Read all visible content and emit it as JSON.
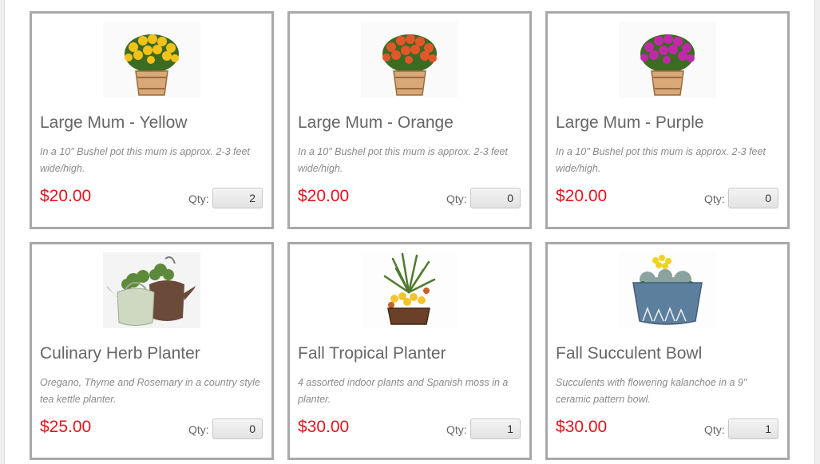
{
  "products": [
    {
      "name": "Large Mum - Yellow",
      "description": "In a 10\" Bushel pot this mum is approx. 2-3 feet wide/high.",
      "price": "$20.00",
      "qty_label": "Qty:",
      "qty_value": "2",
      "image_icon": "yellow-mum-basket-image",
      "flower_color": "#f2c21b"
    },
    {
      "name": "Large Mum - Orange",
      "description": "In a 10\" Bushel pot this mum is approx. 2-3 feet wide/high.",
      "price": "$20.00",
      "qty_label": "Qty:",
      "qty_value": "0",
      "image_icon": "orange-mum-basket-image",
      "flower_color": "#e2562b"
    },
    {
      "name": "Large Mum - Purple",
      "description": "In a 10\" Bushel pot this mum is approx. 2-3 feet wide/high.",
      "price": "$20.00",
      "qty_label": "Qty:",
      "qty_value": "0",
      "image_icon": "purple-mum-basket-image",
      "flower_color": "#c02aa8"
    },
    {
      "name": "Culinary Herb Planter",
      "description": "Oregano, Thyme and Rosemary in a country style tea kettle planter.",
      "price": "$25.00",
      "qty_label": "Qty:",
      "qty_value": "0",
      "image_icon": "herb-kettle-planter-image"
    },
    {
      "name": "Fall Tropical Planter",
      "description": "4 assorted indoor plants and Spanish moss in a planter.",
      "price": "$30.00",
      "qty_label": "Qty:",
      "qty_value": "1",
      "image_icon": "tropical-planter-image"
    },
    {
      "name": "Fall Succulent Bowl",
      "description": "Succulents with flowering kalanchoe in a 9\" ceramic pattern bowl.",
      "price": "$30.00",
      "qty_label": "Qty:",
      "qty_value": "1",
      "image_icon": "succulent-bowl-image"
    }
  ],
  "colors": {
    "price": "#e3141d",
    "card_border": "#a9a9a9",
    "name_text": "#666666"
  }
}
